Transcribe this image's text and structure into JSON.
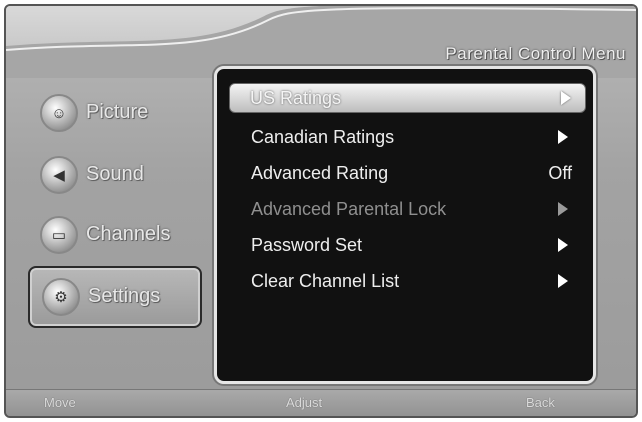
{
  "header": {
    "title": "Parental Control Menu"
  },
  "sidebar": {
    "items": [
      {
        "label": "Picture",
        "icon": "picture-icon",
        "glyph": "☺"
      },
      {
        "label": "Sound",
        "icon": "speaker-icon",
        "glyph": "◀"
      },
      {
        "label": "Channels",
        "icon": "channels-icon",
        "glyph": "▭"
      },
      {
        "label": "Settings",
        "icon": "gear-icon",
        "glyph": "⚙"
      }
    ],
    "selected": "Settings"
  },
  "menu": {
    "items": [
      {
        "label": "US Ratings",
        "state": "highlighted",
        "has_arrow": true
      },
      {
        "label": "Canadian Ratings",
        "state": "normal",
        "has_arrow": true
      },
      {
        "label": "Advanced Rating",
        "state": "normal",
        "value": "Off"
      },
      {
        "label": "Advanced Parental Lock",
        "state": "disabled",
        "has_arrow": true
      },
      {
        "label": "Password Set",
        "state": "normal",
        "has_arrow": true
      },
      {
        "label": "Clear Channel List",
        "state": "normal",
        "has_arrow": true
      }
    ]
  },
  "footer": {
    "hints": [
      "Move",
      "Adjust",
      "Back"
    ]
  }
}
